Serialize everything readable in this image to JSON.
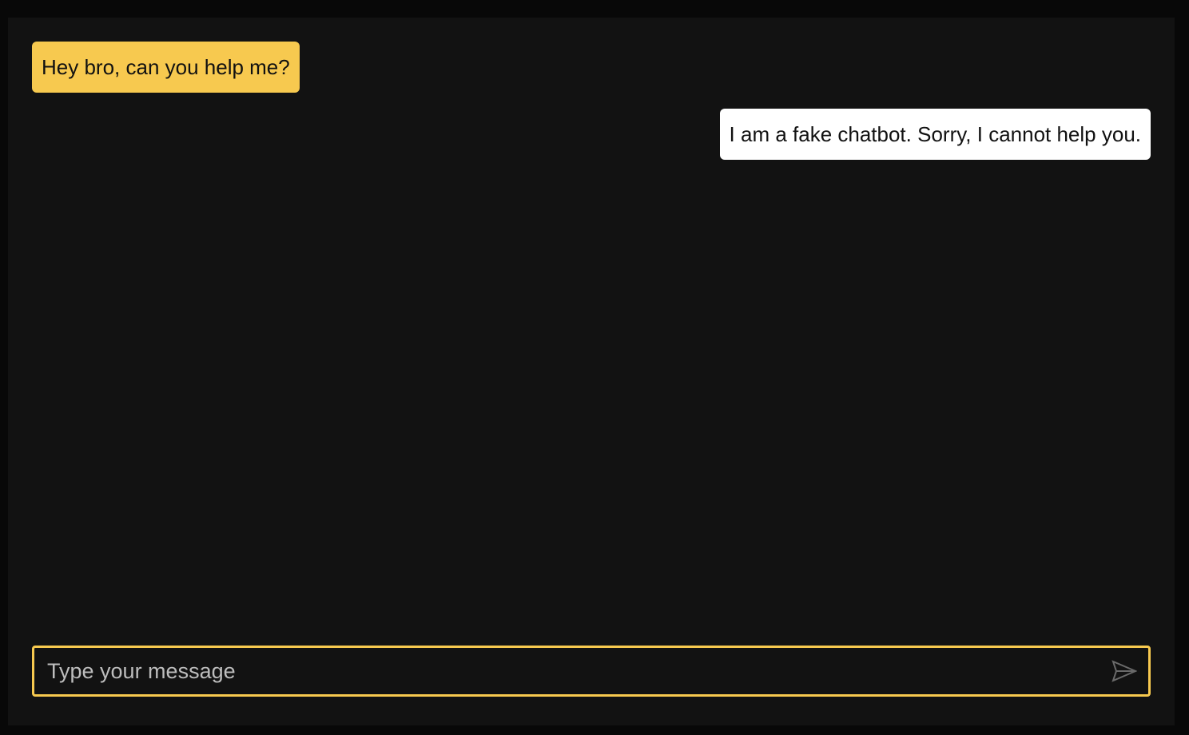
{
  "chat": {
    "messages": [
      {
        "sender": "user",
        "text": "Hey bro, can you help me?"
      },
      {
        "sender": "bot",
        "text": "I am a fake chatbot. Sorry, I cannot help you."
      }
    ]
  },
  "composer": {
    "value": "",
    "placeholder": "Type your message",
    "send_icon": "send-icon"
  },
  "colors": {
    "accent": "#f7c94f",
    "panel": "#121212",
    "bot_bubble": "#ffffff"
  }
}
